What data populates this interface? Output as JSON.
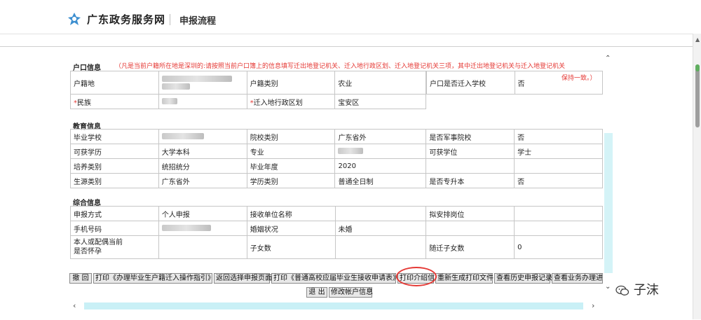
{
  "header": {
    "brand": "广东政务服务网",
    "crumb": "申报流程"
  },
  "hukou": {
    "title": "户口信息",
    "note_line1": "（凡是当前户籍所在地是深圳的:请按照当前户口簿上的信息填写迁出地登记机关、迁入地行政区划、迁入地登记机关三项，其中迁出地登记机关与迁入地登记机关",
    "note_line2": "保持一致。）",
    "rows": [
      [
        "户籍地",
        "",
        "户籍类别",
        "农业",
        "户口是否迁入学校",
        "否"
      ],
      [
        "民族",
        "",
        "迁入地行政区划",
        "宝安区"
      ]
    ]
  },
  "education": {
    "title": "教育信息",
    "rows": [
      [
        "毕业学校",
        "",
        "院校类别",
        "广东省外",
        "是否军事院校",
        "否"
      ],
      [
        "可获学历",
        "大学本科",
        "专业",
        "",
        "可获学位",
        "学士"
      ],
      [
        "培养类别",
        "统招统分",
        "毕业年度",
        "2020",
        "",
        ""
      ],
      [
        "生源类别",
        "广东省外",
        "学历类别",
        "普通全日制",
        "是否专升本",
        "否"
      ]
    ]
  },
  "general": {
    "title": "综合信息",
    "rows": [
      [
        "申报方式",
        "个人申报",
        "接收单位名称",
        "",
        "拟安排岗位",
        ""
      ],
      [
        "手机号码",
        "",
        "婚姻状况",
        "未婚",
        "",
        ""
      ],
      [
        "本人或配偶当前",
        "是否怀孕",
        "子女数",
        "",
        "随迁子女数",
        "0"
      ]
    ]
  },
  "buttons": {
    "undo": "撤 回",
    "print_guide": "打印《办理毕业生户籍迁入操作指引》",
    "back_select": "返回选择申报页面",
    "print_form": "打印《普通高校应届毕业生接收申请表》",
    "print_letter": "打印介绍信",
    "regen": "重新生成打印文件",
    "history": "查看历史申报记录",
    "progress": "查看业务办理进度",
    "exit": "退 出",
    "modify": "修改帐户信息"
  },
  "watermark": "子沫",
  "colors": {
    "note_red": "#e53935",
    "scroll_cyan": "#c9f0f6"
  }
}
